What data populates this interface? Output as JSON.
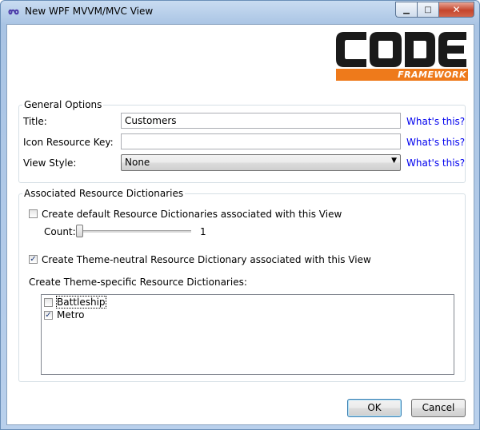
{
  "window": {
    "title": "New WPF MVVM/MVC View",
    "minimize_glyph": "▁",
    "maximize_glyph": "□",
    "close_glyph": "✕"
  },
  "logo": {
    "word": "CODE",
    "sub": "FRAMEWORK",
    "accent_color": "#ee7a1b"
  },
  "general": {
    "group_title": "General Options",
    "title_label": "Title:",
    "title_value": "Customers",
    "icon_label": "Icon Resource Key:",
    "icon_value": "",
    "viewstyle_label": "View Style:",
    "viewstyle_value": "None",
    "help_link": "What's this?"
  },
  "resources": {
    "group_title": "Associated Resource Dictionaries",
    "default_dicts_label": "Create default Resource Dictionaries associated with this View",
    "default_dicts_checked": false,
    "count_label": "Count:",
    "count_value": "1",
    "theme_neutral_label": "Create Theme-neutral Resource Dictionary associated with this View",
    "theme_neutral_checked": true,
    "theme_specific_label": "Create Theme-specific Resource Dictionaries:",
    "themes": [
      {
        "name": "Battleship",
        "checked": false
      },
      {
        "name": "Metro",
        "checked": true
      }
    ]
  },
  "buttons": {
    "ok": "OK",
    "cancel": "Cancel"
  }
}
